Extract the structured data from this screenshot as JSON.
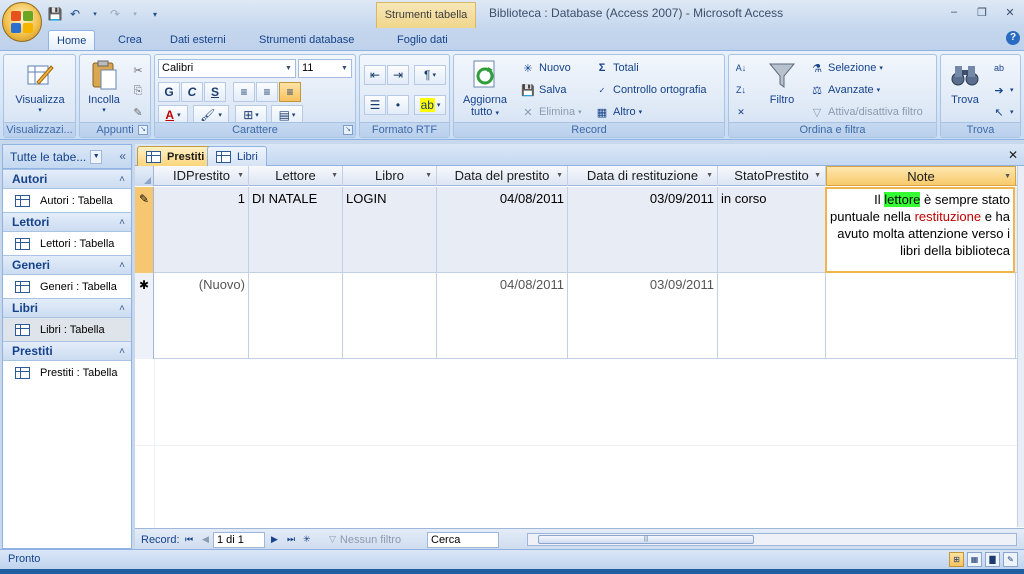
{
  "app": {
    "window_title": "Biblioteca : Database (Access 2007) - Microsoft Access",
    "context_tab_header": "Strumenti tabella"
  },
  "ribbon": {
    "tabs": [
      "Home",
      "Crea",
      "Dati esterni",
      "Strumenti database",
      "Foglio dati"
    ],
    "active_tab": "Home",
    "groups": {
      "views": {
        "label": "Visualizzazioni",
        "label_short": "Visualizzazi...",
        "visualizza": "Visualizza"
      },
      "clipboard": {
        "label": "Appunti",
        "paste": "Incolla"
      },
      "font": {
        "label": "Carattere",
        "font_name": "Calibri",
        "font_size": "11",
        "bold": "G",
        "italic": "C",
        "underline": "S",
        "font_color_glyph": "A"
      },
      "rtf": {
        "label": "Formato RTF"
      },
      "records": {
        "label": "Record",
        "refresh": "Aggiorna tutto",
        "refresh_line1": "Aggiorna",
        "refresh_line2": "tutto",
        "new": "Nuovo",
        "save": "Salva",
        "delete": "Elimina",
        "totals": "Totali",
        "spelling": "Controllo ortografia",
        "more": "Altro"
      },
      "sort_filter": {
        "label": "Ordina e filtra",
        "filter": "Filtro",
        "selection": "Selezione",
        "advanced": "Avanzate",
        "toggle_filter": "Attiva/disattiva filtro"
      },
      "find": {
        "label": "Trova",
        "find": "Trova"
      }
    }
  },
  "nav_pane": {
    "header": "Tutte le tabe...",
    "groups": [
      {
        "title": "Autori",
        "items": [
          "Autori : Tabella"
        ]
      },
      {
        "title": "Lettori",
        "items": [
          "Lettori : Tabella"
        ]
      },
      {
        "title": "Generi",
        "items": [
          "Generi : Tabella"
        ]
      },
      {
        "title": "Libri",
        "items": [
          "Libri : Tabella"
        ]
      },
      {
        "title": "Prestiti",
        "items": [
          "Prestiti : Tabella"
        ]
      }
    ],
    "selected_item": "Libri : Tabella"
  },
  "documents": {
    "tabs": [
      "Prestiti",
      "Libri"
    ],
    "active_tab": "Prestiti"
  },
  "datasheet": {
    "columns": [
      "IDPrestito",
      "Lettore",
      "Libro",
      "Data del prestito",
      "Data di restituzione",
      "StatoPrestito",
      "Note"
    ],
    "rows": [
      {
        "indicator": "pencil",
        "IDPrestito": "1",
        "Lettore": "DI NATALE",
        "Libro": "LOGIN",
        "DataPrestito": "04/08/2011",
        "DataRestituzione": "03/09/2011",
        "StatoPrestito": "in corso",
        "Note": {
          "p1": "Il ",
          "highlight": "lettore",
          "p2": " è sempre stato puntuale nella ",
          "red": "restituzione",
          "p3": " e ha avuto molta attenzione verso i libri della biblioteca"
        }
      },
      {
        "indicator": "new",
        "IDPrestito": "(Nuovo)",
        "Lettore": "",
        "Libro": "",
        "DataPrestito": "04/08/2011",
        "DataRestituzione": "03/09/2011",
        "StatoPrestito": "",
        "Note": ""
      }
    ]
  },
  "record_nav": {
    "label": "Record:",
    "position": "1 di 1",
    "filter": "Nessun filtro",
    "search_placeholder": "Cerca"
  },
  "status": {
    "text": "Pronto"
  },
  "colors": {
    "ribbon_blue": "#15428b",
    "active_orange": "#f8ca6a",
    "highlight_green": "#33ff33",
    "text_red": "#c00000"
  }
}
